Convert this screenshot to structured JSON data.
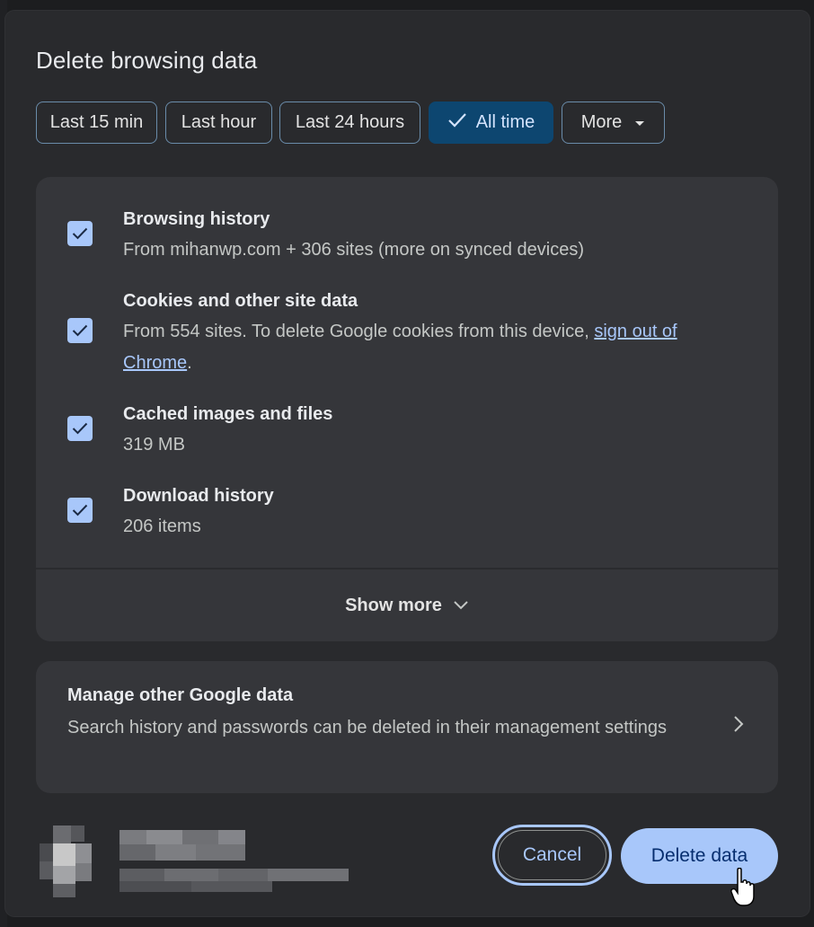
{
  "dialog": {
    "title": "Delete browsing data",
    "time_ranges": [
      {
        "label": "Last 15 min",
        "selected": false
      },
      {
        "label": "Last hour",
        "selected": false
      },
      {
        "label": "Last 24 hours",
        "selected": false
      },
      {
        "label": "All time",
        "selected": true
      },
      {
        "label": "More",
        "selected": false
      }
    ],
    "items": [
      {
        "title": "Browsing history",
        "desc": "From mihanwp.com + 306 sites (more on synced devices)",
        "checked": true
      },
      {
        "title": "Cookies and other site data",
        "desc_before": "From 554 sites. To delete Google cookies from this device, ",
        "desc_link": "sign out of Chrome",
        "desc_after": ".",
        "checked": true
      },
      {
        "title": "Cached images and files",
        "desc": "319 MB",
        "checked": true
      },
      {
        "title": "Download history",
        "desc": "206 items",
        "checked": true
      }
    ],
    "show_more": "Show more",
    "manage": {
      "title": "Manage other Google data",
      "desc": "Search history and passwords can be deleted in their management settings"
    },
    "buttons": {
      "cancel": "Cancel",
      "delete": "Delete data"
    }
  },
  "colors": {
    "accent": "#a8c7fa",
    "selected_chip_bg": "#0d4670",
    "dialog_bg": "#292a2d",
    "panel_bg": "#35363a"
  },
  "icons": {
    "selected_chip": "checkmark-icon",
    "more_chip": "caret-down-icon",
    "show_more": "chevron-down-icon",
    "manage": "chevron-right-icon",
    "checkbox": "checkbox-checked-icon"
  }
}
